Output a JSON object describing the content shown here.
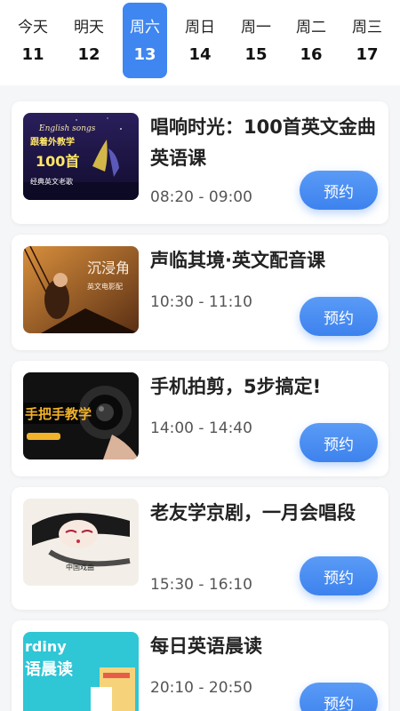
{
  "dates": [
    {
      "weekday": "今天",
      "day": "11"
    },
    {
      "weekday": "明天",
      "day": "12"
    },
    {
      "weekday": "周六",
      "day": "13",
      "selected": true
    },
    {
      "weekday": "周日",
      "day": "14"
    },
    {
      "weekday": "周一",
      "day": "15"
    },
    {
      "weekday": "周二",
      "day": "16"
    },
    {
      "weekday": "周三",
      "day": "17"
    }
  ],
  "courses": [
    {
      "title": "唱响时光：100首英文金曲英语课",
      "time": "08:20 - 09:00",
      "button": "预约",
      "thumb": {
        "line1": "English songs",
        "line2": "跟着外教学",
        "line3": "100首",
        "line4": "经典英文老歌"
      }
    },
    {
      "title": "声临其境·英文配音课",
      "time": "10:30 - 11:10",
      "button": "预约",
      "thumb": {
        "line1": "沉浸角",
        "line2": "英文电影配"
      }
    },
    {
      "title": "手机拍剪，5步搞定!",
      "time": "14:00 - 14:40",
      "button": "预约",
      "thumb": {
        "line1": "手把手教学"
      }
    },
    {
      "title": "老友学京剧，一月会唱段",
      "time": "15:30 - 16:10",
      "button": "预约",
      "thumb": {
        "line1": "中国戏曲"
      }
    },
    {
      "title": "每日英语晨读",
      "time": "20:10 - 20:50",
      "button": "预约",
      "thumb": {
        "line1": "rdiny",
        "line2": "语晨读"
      }
    }
  ],
  "colors": {
    "accent": "#3f86f0",
    "background": "#f5f6f8"
  }
}
